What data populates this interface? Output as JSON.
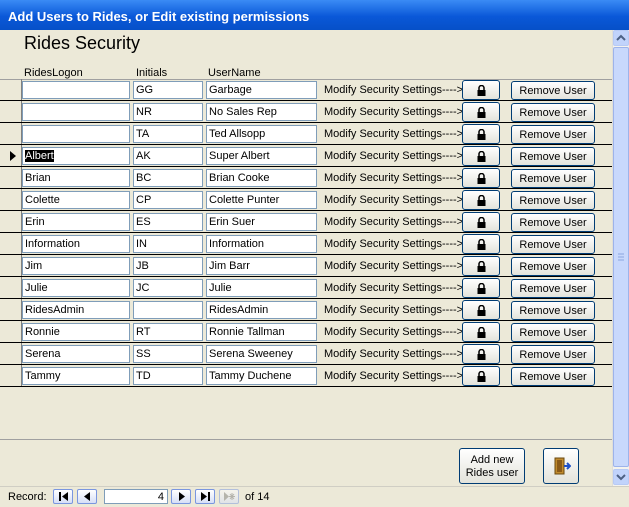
{
  "window": {
    "title": "Add Users to Rides, or Edit existing permissions"
  },
  "form": {
    "heading": "Rides Security",
    "columns": {
      "logon": "RidesLogon",
      "initials": "Initials",
      "username": "UserName"
    },
    "modify_label": "Modify Security Settings---->",
    "lock_icon": "lock-icon",
    "remove_label": "Remove User",
    "rows": [
      {
        "logon": "",
        "initials": "GG",
        "username": "Garbage"
      },
      {
        "logon": "",
        "initials": "NR",
        "username": "No Sales Rep"
      },
      {
        "logon": "",
        "initials": "TA",
        "username": "Ted Allsopp"
      },
      {
        "logon": "Albert",
        "initials": "AK",
        "username": "Super Albert"
      },
      {
        "logon": "Brian",
        "initials": "BC",
        "username": "Brian Cooke"
      },
      {
        "logon": "Colette",
        "initials": "CP",
        "username": "Colette Punter"
      },
      {
        "logon": "Erin",
        "initials": "ES",
        "username": "Erin Suer"
      },
      {
        "logon": "Information",
        "initials": "IN",
        "username": "Information"
      },
      {
        "logon": "Jim",
        "initials": "JB",
        "username": "Jim Barr"
      },
      {
        "logon": "Julie",
        "initials": "JC",
        "username": "Julie"
      },
      {
        "logon": "RidesAdmin",
        "initials": "",
        "username": "RidesAdmin"
      },
      {
        "logon": "Ronnie",
        "initials": "RT",
        "username": "Ronnie Tallman"
      },
      {
        "logon": "Serena",
        "initials": "SS",
        "username": "Serena Sweeney"
      },
      {
        "logon": "Tammy",
        "initials": "TD",
        "username": "Tammy Duchene"
      }
    ],
    "current_row": 3,
    "add_button_line1": "Add new",
    "add_button_line2": "Rides user",
    "exit_icon": "exit-door-icon"
  },
  "navigation": {
    "record_label": "Record:",
    "current": "4",
    "of_label": "of",
    "total": "14"
  }
}
